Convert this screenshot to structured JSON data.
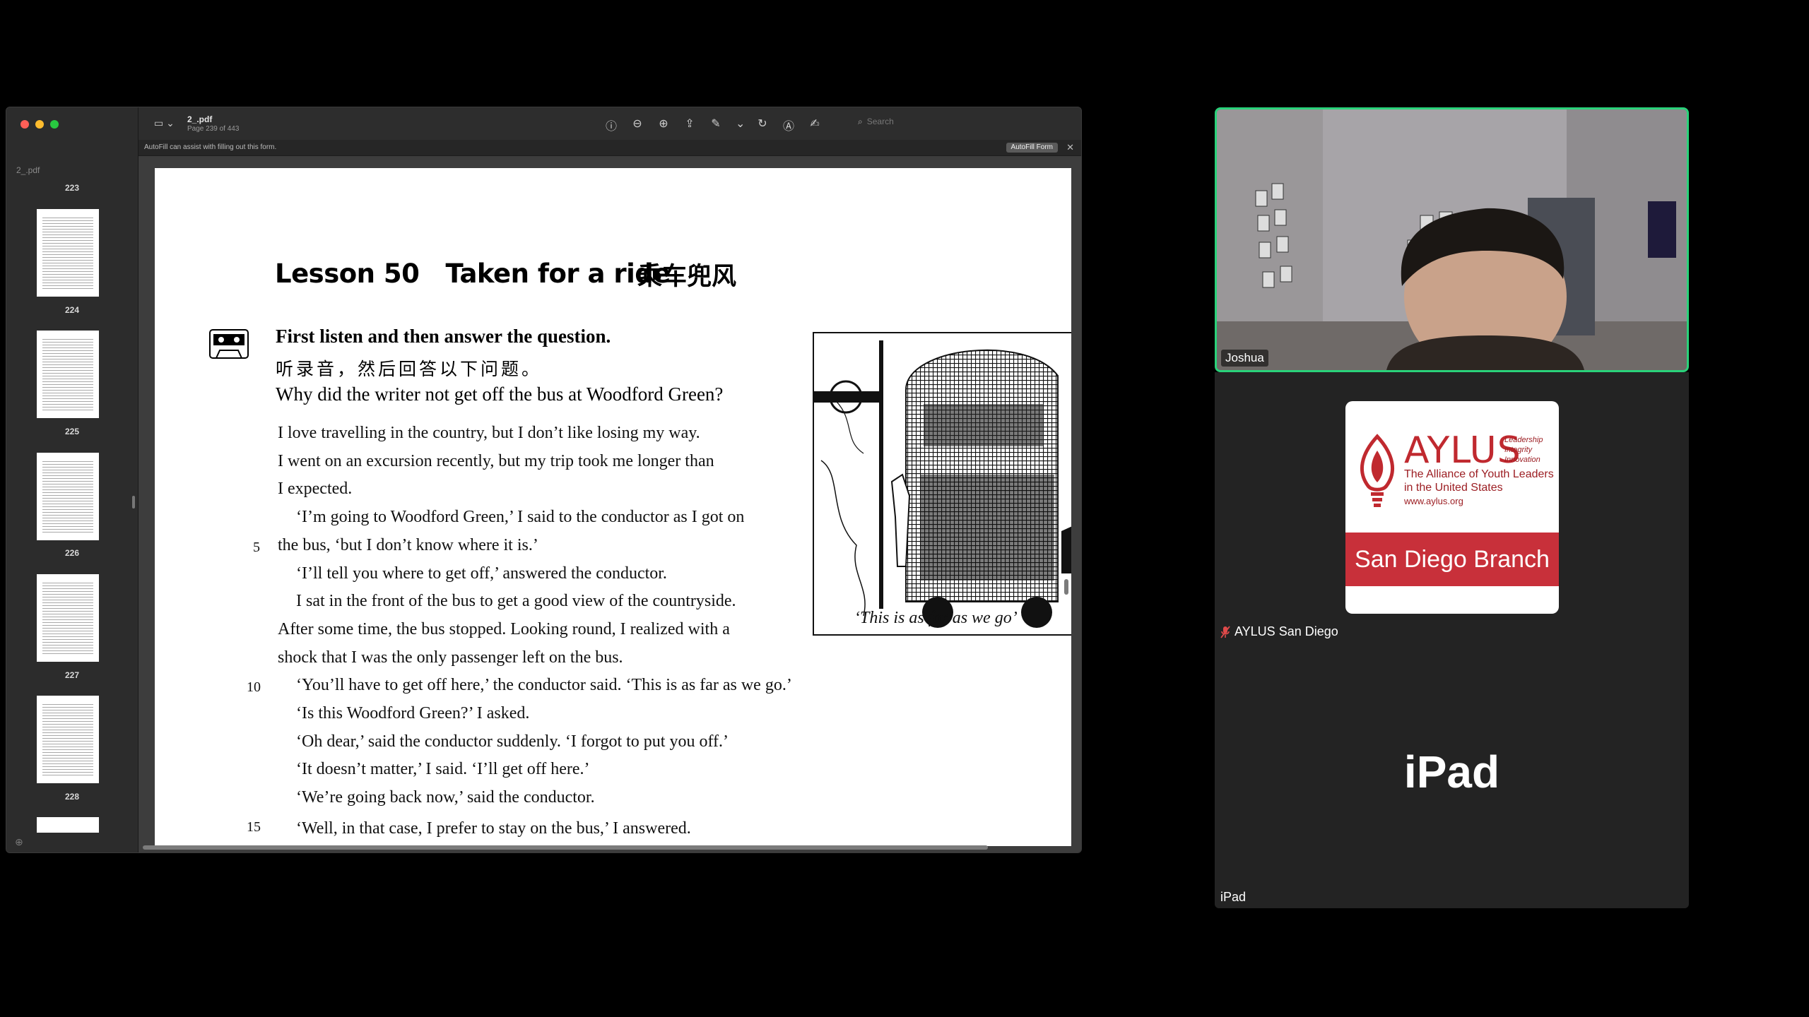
{
  "viewer": {
    "file_name": "2_.pdf",
    "page_info": "Page 239 of 443",
    "sidebar_file_label": "2_.pdf",
    "sidebar_first_number": "223",
    "thumbnails": [
      {
        "label": "224"
      },
      {
        "label": "225"
      },
      {
        "label": "226"
      },
      {
        "label": "227"
      },
      {
        "label": "228"
      }
    ],
    "toolbar_icons": [
      "info-icon",
      "zoom-out-icon",
      "zoom-in-icon",
      "share-icon",
      "markup-icon",
      "chevron-down-icon",
      "rotate-icon",
      "highlight-icon",
      "sign-icon"
    ],
    "search_placeholder": "Search",
    "autofill_text": "AutoFill can assist with filling out this form.",
    "autofill_button": "AutoFill Form"
  },
  "pdf_page": {
    "lesson_title": "Lesson 50   Taken for a ride",
    "lesson_title_cn": "乘车兜风",
    "instruction": "First listen and then answer the question.",
    "instruction_cn": "听录音，然后回答以下问题。",
    "question": "Why did the writer not get off the bus at Woodford Green?",
    "lines": [
      "I love travelling in the country, but I don’t like losing my way.",
      "I went on an excursion recently, but my trip took me longer than",
      "I expected.",
      "‘I’m going to Woodford Green,’ I said to the conductor as I got on",
      "the bus, ‘but I don’t know where it is.’",
      "‘I’ll tell you where to get off,’ answered the conductor.",
      "I sat in the front of the bus to get a good view of the countryside.",
      "After some time, the bus stopped. Looking round, I realized with a",
      "shock that I was the only passenger left on the bus.",
      "‘You’ll have to get off here,’ the conductor said. ‘This is as far as we go.’",
      "‘Is this Woodford Green?’ I asked.",
      "‘Oh dear,’ said the conductor suddenly. ‘I forgot to put you off.’",
      "‘It doesn’t matter,’ I said. ‘I’ll get off here.’",
      "‘We’re going back now,’ said the conductor.",
      "‘Well, in that case, I prefer to stay on the bus,’ I answered."
    ],
    "line_numbers": [
      "5",
      "10",
      "15"
    ],
    "caption": "‘This is as far as we go’"
  },
  "participants": {
    "video_name": "Joshua",
    "logo_brand": "AYLUS",
    "logo_tagline": [
      "Leadership",
      "Integrity",
      "Innovation"
    ],
    "logo_alliance": "The Alliance of Youth Leaders in the United States",
    "logo_url": "www.aylus.org",
    "logo_branch": "San Diego Branch",
    "logo_participant_name": "AYLUS San Diego",
    "ipad_big": "iPad",
    "ipad_name": "iPad"
  },
  "colors": {
    "active_speaker_border": "#2ad27a",
    "aylus_red": "#c8303a"
  }
}
